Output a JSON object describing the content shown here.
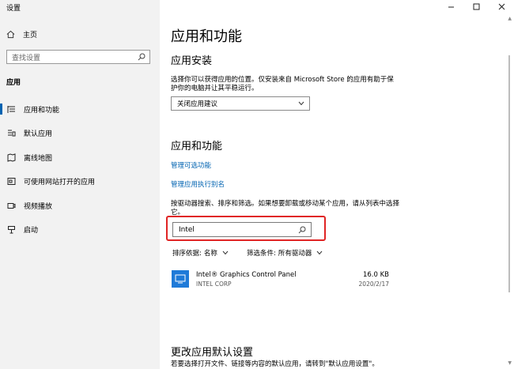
{
  "window": {
    "title": "设置"
  },
  "sidebar": {
    "home_label": "主页",
    "search_placeholder": "查找设置",
    "section_title": "应用",
    "items": [
      {
        "label": "应用和功能",
        "icon": "apps-features-icon",
        "active": true
      },
      {
        "label": "默认应用",
        "icon": "default-apps-icon",
        "active": false
      },
      {
        "label": "离线地图",
        "icon": "offline-maps-icon",
        "active": false
      },
      {
        "label": "可使用网站打开的应用",
        "icon": "apps-for-websites-icon",
        "active": false
      },
      {
        "label": "视频播放",
        "icon": "video-playback-icon",
        "active": false
      },
      {
        "label": "启动",
        "icon": "startup-icon",
        "active": false
      }
    ]
  },
  "main": {
    "title": "应用和功能",
    "install_heading": "应用安装",
    "install_desc": "选择你可以获得应用的位置。仅安装来自 Microsoft Store 的应用有助于保护你的电脑并让其平稳运行。",
    "install_dropdown_value": "关闭应用建议",
    "features_heading": "应用和功能",
    "link_optional": "管理可选功能",
    "link_alias": "管理应用执行别名",
    "search_desc": "按驱动器搜索、排序和筛选。如果想要卸载或移动某个应用，请从列表中选择它。",
    "search_value": "Intel",
    "sort_label": "排序依据:",
    "sort_value": "名称",
    "filter_label": "筛选条件:",
    "filter_value": "所有驱动器",
    "apps": [
      {
        "name": "Intel® Graphics Control Panel",
        "publisher": "INTEL CORP",
        "size": "16.0 KB",
        "date": "2020/2/17"
      }
    ],
    "defaults_heading": "更改应用默认设置",
    "defaults_desc": "若要选择打开文件、链接等内容的默认应用，请转到\"默认应用设置\"。"
  },
  "colors": {
    "accent": "#0063b1",
    "highlight": "#e02424",
    "sidebar_bg": "#f2f2f2"
  }
}
